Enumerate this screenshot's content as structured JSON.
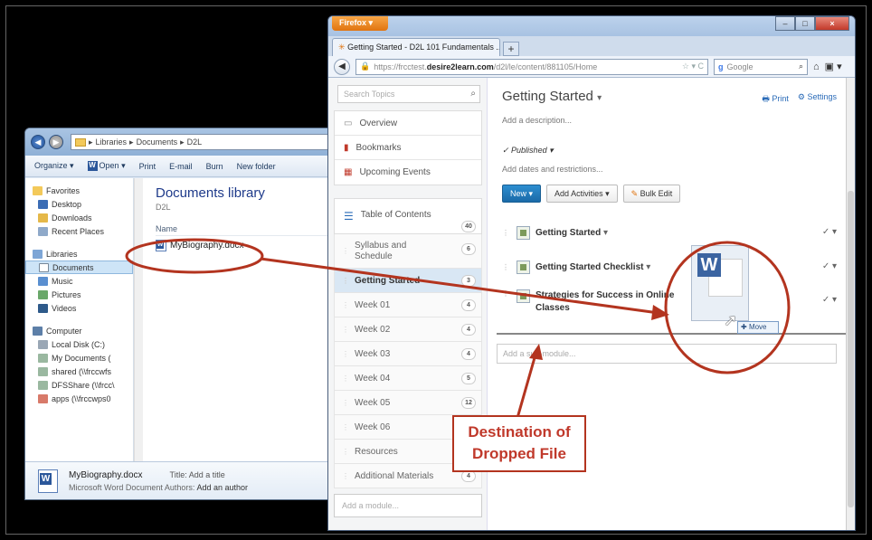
{
  "explorer": {
    "breadcrumb": [
      "Libraries",
      "Documents",
      "D2L"
    ],
    "toolbar": [
      "Organize ▾",
      "Open ▾",
      "Print",
      "E-mail",
      "Burn",
      "New folder"
    ],
    "nav": {
      "favorites": "Favorites",
      "desktop": "Desktop",
      "downloads": "Downloads",
      "recent": "Recent Places",
      "libraries": "Libraries",
      "documents": "Documents",
      "music": "Music",
      "pictures": "Pictures",
      "videos": "Videos",
      "computer": "Computer",
      "local_disk": "Local Disk (C:)",
      "my_documents": "My Documents (",
      "shared": "shared (\\\\frccwfs",
      "dfsshare": "DFSShare (\\\\frcc\\",
      "apps": "apps (\\\\frccwps0"
    },
    "library_title": "Documents library",
    "library_sub": "D2L",
    "column_name": "Name",
    "file_name": "MyBiography.docx",
    "details": {
      "name": "MyBiography.docx",
      "type_line": "Microsoft Word Document",
      "title_label": "Title:",
      "title_value": "Add a title",
      "authors_label": "Authors:",
      "authors_value": "Add an author"
    }
  },
  "firefox": {
    "menu_button": "Firefox",
    "tab_title": "Getting Started - D2L 101 Fundamentals ...",
    "url_prefix": "https://frcctest.",
    "url_domain": "desire2learn.com",
    "url_path": "/d2l/le/content/881105/Home",
    "search_engine": "Google"
  },
  "d2l": {
    "search_placeholder": "Search Topics",
    "side_items": [
      "Overview",
      "Bookmarks",
      "Upcoming Events"
    ],
    "toc_label": "Table of Contents",
    "toc_count": "40",
    "modules": [
      {
        "label": "Syllabus and Schedule",
        "count": "6"
      },
      {
        "label": "Getting Started",
        "count": "3"
      },
      {
        "label": "Week 01",
        "count": "4"
      },
      {
        "label": "Week 02",
        "count": "4"
      },
      {
        "label": "Week 03",
        "count": "4"
      },
      {
        "label": "Week 04",
        "count": "5"
      },
      {
        "label": "Week 05",
        "count": "12"
      },
      {
        "label": "Week 06",
        "count": ""
      },
      {
        "label": "Resources",
        "count": ""
      },
      {
        "label": "Additional Materials",
        "count": "4"
      }
    ],
    "add_module_placeholder": "Add a module...",
    "page_title": "Getting Started",
    "print_label": "Print",
    "settings_label": "Settings",
    "add_description": "Add a description...",
    "published": "Published",
    "add_dates": "Add dates and restrictions...",
    "new_button": "New",
    "add_activities": "Add Activities",
    "bulk_edit": "Bulk Edit",
    "topics": [
      "Getting Started",
      "Getting Started Checklist",
      "Strategies for Success in Online Classes"
    ],
    "add_submodule_placeholder": "Add a sub-module...",
    "move_tooltip": "Move"
  },
  "annotation": {
    "line1": "Destination of",
    "line2": "Dropped File",
    "color": "#b3341f"
  }
}
